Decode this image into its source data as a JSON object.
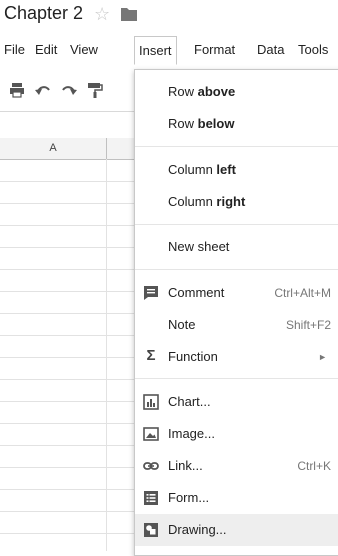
{
  "doc": {
    "title": "Chapter 2"
  },
  "menubar": {
    "items": [
      "File",
      "Edit",
      "View",
      "Insert",
      "Format",
      "Data",
      "Tools"
    ]
  },
  "grid": {
    "columns": [
      "A"
    ]
  },
  "insert_menu": {
    "row_above": {
      "pre": "Row ",
      "bold": "above"
    },
    "row_below": {
      "pre": "Row ",
      "bold": "below"
    },
    "column_left": {
      "pre": "Column ",
      "bold": "left"
    },
    "column_right": {
      "pre": "Column ",
      "bold": "right"
    },
    "new_sheet": "New sheet",
    "comment": {
      "label": "Comment",
      "shortcut": "Ctrl+Alt+M"
    },
    "note": {
      "label": "Note",
      "shortcut": "Shift+F2"
    },
    "function": {
      "label": "Function",
      "arrow": "►"
    },
    "chart": "Chart...",
    "image": "Image...",
    "link": {
      "label": "Link...",
      "shortcut": "Ctrl+K"
    },
    "form": "Form...",
    "drawing": "Drawing..."
  },
  "icons": {
    "star": "star-icon",
    "folder": "folder-icon",
    "print": "print-icon",
    "undo": "undo-icon",
    "redo": "redo-icon",
    "paint_format": "paint-format-icon",
    "comment": "comment-icon",
    "function": "sigma-icon",
    "chart": "chart-icon",
    "image": "image-icon",
    "link": "link-icon",
    "form": "form-icon",
    "drawing": "drawing-icon"
  },
  "colors": {
    "highlight": "#eeeeee",
    "icon": "#555555",
    "star": "#c8c8c8"
  }
}
